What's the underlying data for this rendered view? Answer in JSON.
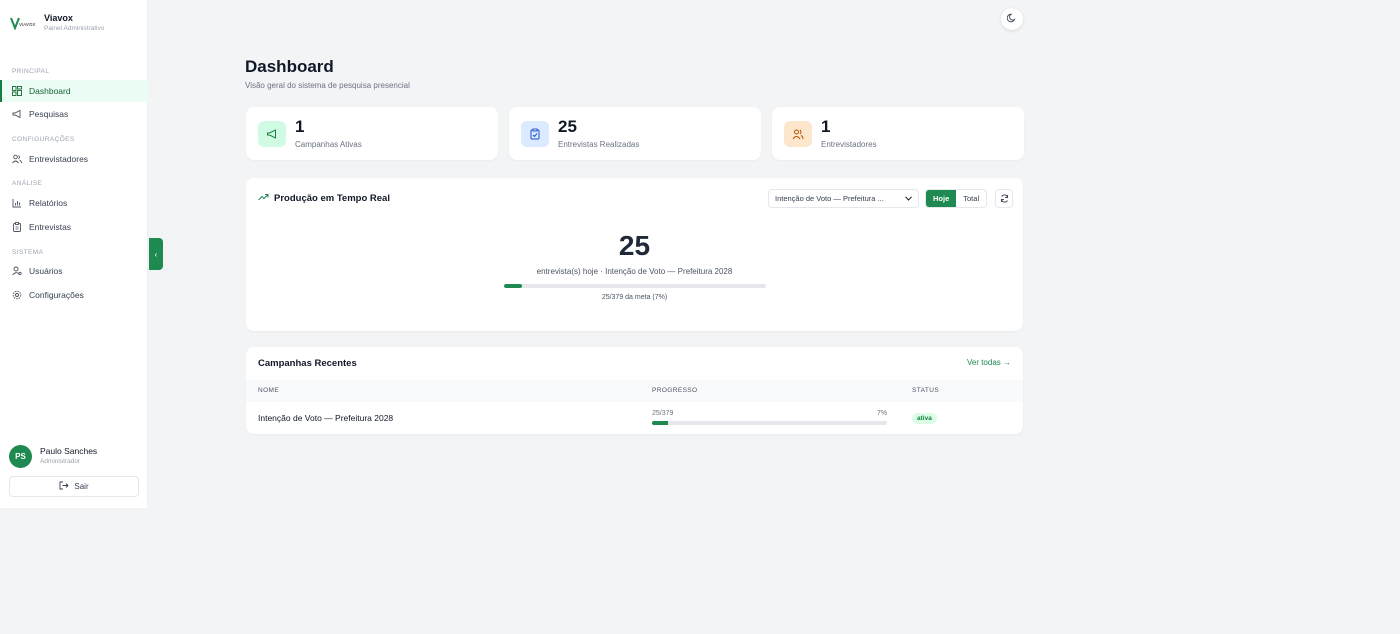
{
  "brand": {
    "name": "Viavox",
    "subtitle": "Painel Administrativo",
    "logo_text": "VIAVOX"
  },
  "sidebar": {
    "sections": [
      {
        "label": "PRINCIPAL",
        "items": [
          {
            "label": "Dashboard",
            "icon": "layout-grid-icon",
            "active": true
          },
          {
            "label": "Pesquisas",
            "icon": "megaphone-icon"
          }
        ]
      },
      {
        "label": "CONFIGURAÇÕES",
        "items": [
          {
            "label": "Entrevistadores",
            "icon": "users-icon"
          }
        ]
      },
      {
        "label": "ANÁLISE",
        "items": [
          {
            "label": "Relatórios",
            "icon": "bar-chart-icon"
          },
          {
            "label": "Entrevistas",
            "icon": "clipboard-icon"
          }
        ]
      },
      {
        "label": "SISTEMA",
        "items": [
          {
            "label": "Usuários",
            "icon": "user-cog-icon"
          },
          {
            "label": "Configurações",
            "icon": "gear-icon"
          }
        ]
      }
    ]
  },
  "user": {
    "initials": "PS",
    "name": "Paulo Sanches",
    "role": "Administrador",
    "logout_label": "Sair"
  },
  "header": {
    "title": "Dashboard",
    "subtitle": "Visão geral do sistema de pesquisa presencial"
  },
  "stats": [
    {
      "value": "1",
      "label": "Campanhas Ativas",
      "icon": "megaphone-icon",
      "bg": "#d1fae5",
      "fg": "#15803d"
    },
    {
      "value": "25",
      "label": "Entrevistas Realizadas",
      "icon": "clipboard-check-icon",
      "bg": "#dbeafe",
      "fg": "#1d4ed8"
    },
    {
      "value": "1",
      "label": "Entrevistadores",
      "icon": "users-icon",
      "bg": "#fde7cc",
      "fg": "#b45309"
    }
  ],
  "production": {
    "title": "Produção em Tempo Real",
    "select_value": "Intenção de Voto — Prefeitura ...",
    "toggle_today": "Hoje",
    "toggle_total": "Total",
    "count": "25",
    "description": "entrevista(s) hoje · Intenção de Voto — Prefeitura 2028",
    "goal_text": "25/379 da meta (7%)",
    "progress": 0.07
  },
  "recent": {
    "title": "Campanhas Recentes",
    "view_all": "Ver todas →",
    "columns": [
      "NOME",
      "PROGRESSO",
      "STATUS"
    ],
    "rows": [
      {
        "name": "Intenção de Voto — Prefeitura 2028",
        "progress_text": "25/379",
        "percent": "7%",
        "progress": 0.07,
        "status": "ativa"
      }
    ]
  },
  "colors": {
    "accent": "#1e8a52"
  }
}
